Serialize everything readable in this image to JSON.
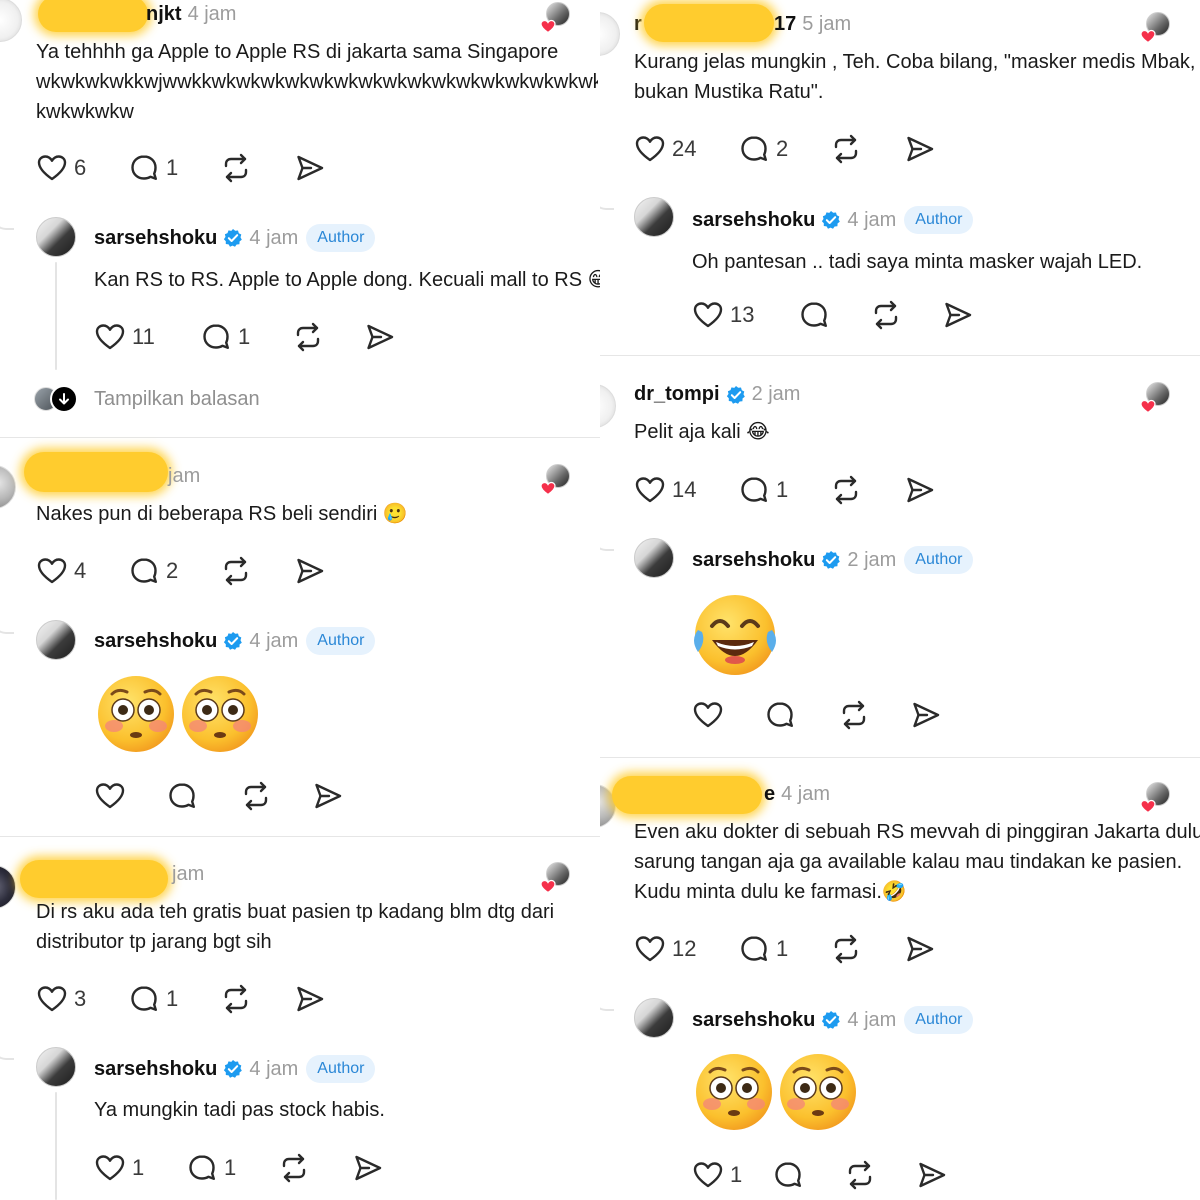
{
  "left": {
    "thread1": {
      "post": {
        "username_visible": "njkt",
        "time": "4 jam",
        "lines": [
          "Ya tehhhh ga Apple to Apple RS di jakarta sama Singapore",
          "wkwkwkwkkwjwwkkwkwkwkwkwkwkwkwkwkwkwkwkwkwkwkwkwkwk",
          "kwkwkwkw"
        ],
        "likes": "6",
        "replies": "1"
      },
      "reply": {
        "username": "sarsehshoku",
        "time": "4 jam",
        "badge": "Author",
        "text": "Kan RS to RS. Apple to Apple dong. Kecuali mall to RS 😁",
        "likes": "11",
        "replies": "1"
      },
      "show_replies": "Tampilkan balasan"
    },
    "thread2": {
      "post": {
        "username_visible": "",
        "time": "jam",
        "text": "Nakes pun di beberapa RS beli sendiri 🥲",
        "likes": "4",
        "replies": "2"
      },
      "reply": {
        "username": "sarsehshoku",
        "time": "4 jam",
        "badge": "Author"
      }
    },
    "thread3": {
      "post": {
        "username_visible": "",
        "time": "jam",
        "lines": [
          "Di rs aku ada teh gratis buat pasien tp kadang blm dtg dari",
          "distributor tp jarang bgt sih"
        ],
        "likes": "3",
        "replies": "1"
      },
      "reply": {
        "username": "sarsehshoku",
        "time": "4 jam",
        "badge": "Author",
        "text": "Ya mungkin tadi pas stock habis.",
        "likes": "1",
        "replies": "1"
      }
    }
  },
  "right": {
    "thread1": {
      "post": {
        "username_prefix": "r",
        "username_suffix": "17",
        "time": "5 jam",
        "lines": [
          "Kurang jelas mungkin , Teh. Coba bilang, \"masker medis Mbak,",
          "bukan Mustika Ratu\"."
        ],
        "likes": "24",
        "replies": "2"
      },
      "reply": {
        "username": "sarsehshoku",
        "time": "4 jam",
        "badge": "Author",
        "text": "Oh pantesan .. tadi saya minta masker wajah LED.",
        "likes": "13"
      }
    },
    "thread2": {
      "post": {
        "username": "dr_tompi",
        "time": "2 jam",
        "text": "Pelit aja kali 😂",
        "likes": "14",
        "replies": "1"
      },
      "reply": {
        "username": "sarsehshoku",
        "time": "2 jam",
        "badge": "Author"
      }
    },
    "thread3": {
      "post": {
        "username_suffix": "e",
        "time": "4 jam",
        "lines": [
          "Even aku dokter di sebuah RS mevvah di pinggiran Jakarta dulu",
          "sarung tangan aja ga available kalau mau tindakan ke pasien.",
          "Kudu minta dulu ke farmasi.🤣"
        ],
        "likes": "12",
        "replies": "1"
      },
      "reply": {
        "username": "sarsehshoku",
        "time": "4 jam",
        "badge": "Author",
        "likes": "1"
      }
    }
  },
  "icons": [
    "heart-icon",
    "comment-icon",
    "repost-icon",
    "share-icon",
    "verified-badge-icon",
    "flushed-face-emoji",
    "tears-of-joy-emoji",
    "down-arrow-icon"
  ],
  "colors": {
    "verified": "#1d9bf0",
    "author_badge_bg": "#e6f2fd",
    "author_badge_text": "#2a87d6",
    "redaction": "#ffcc2e",
    "meta_gray": "#9c9c9c"
  }
}
